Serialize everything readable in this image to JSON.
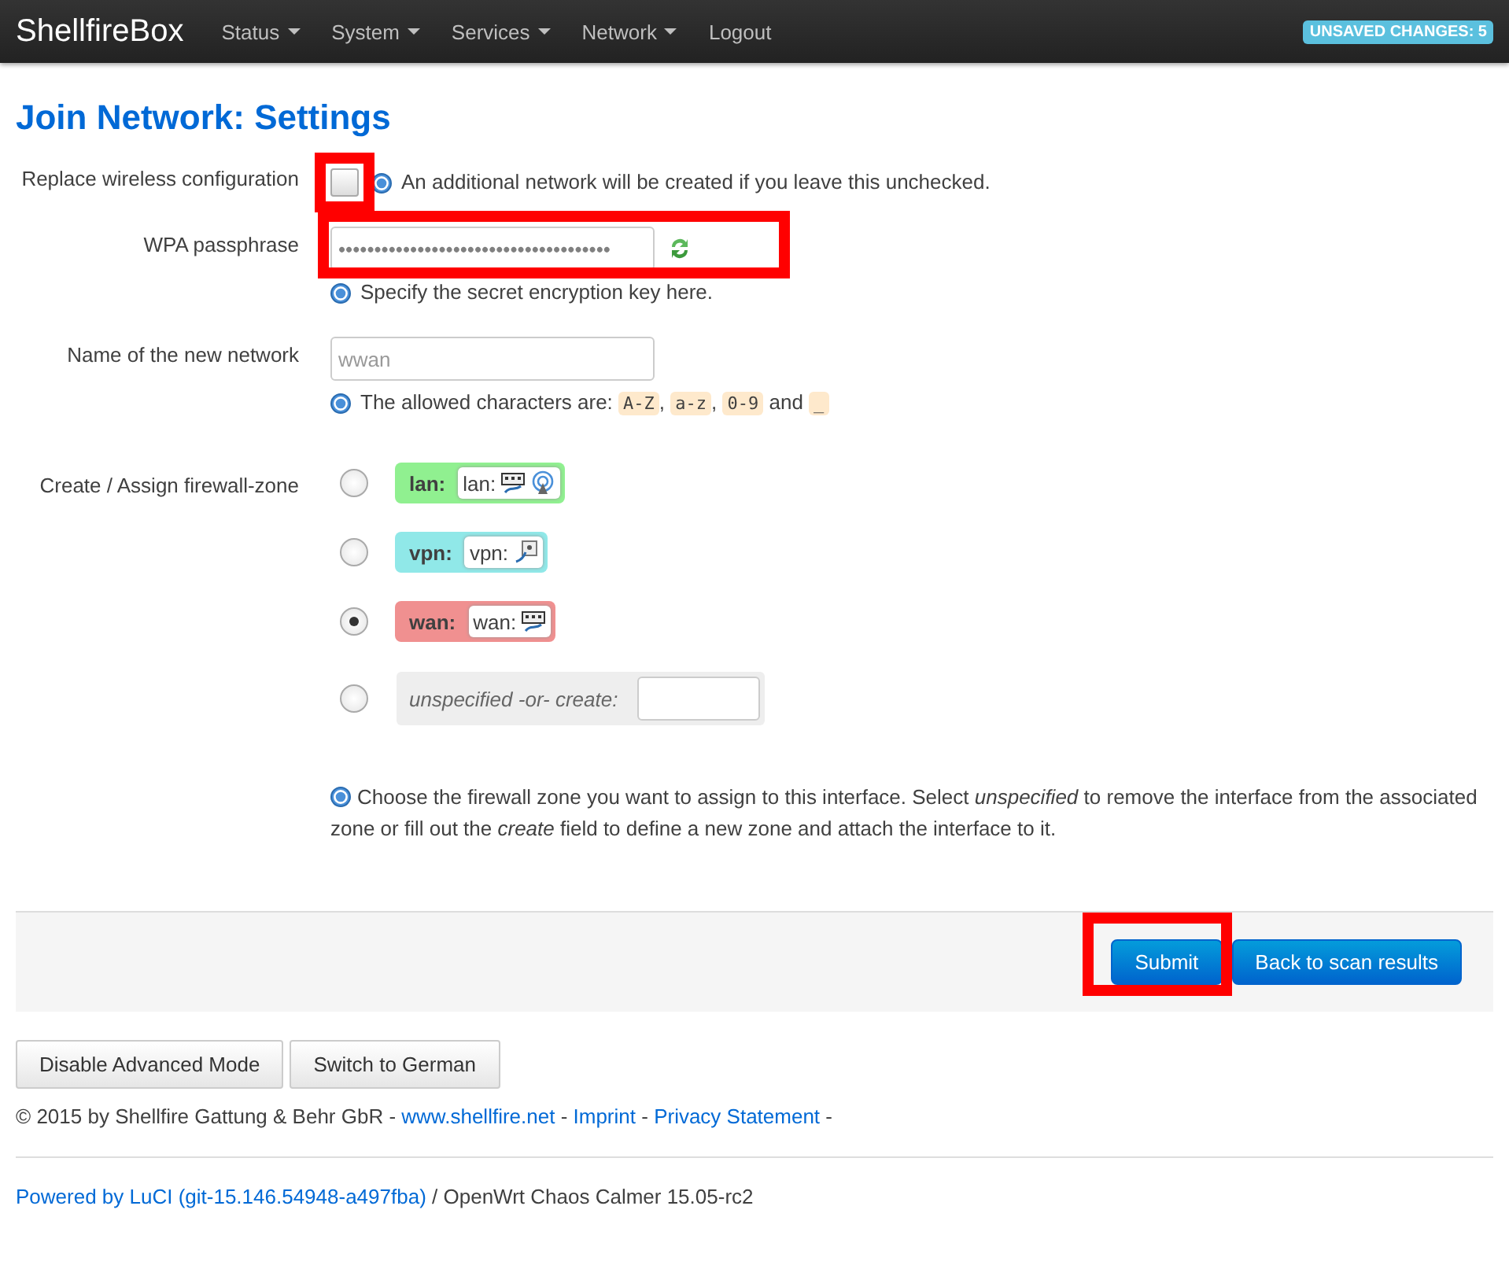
{
  "navbar": {
    "brand": "ShellfireBox",
    "menu": [
      {
        "label": "Status",
        "dropdown": true
      },
      {
        "label": "System",
        "dropdown": true
      },
      {
        "label": "Services",
        "dropdown": true
      },
      {
        "label": "Network",
        "dropdown": true
      },
      {
        "label": "Logout",
        "dropdown": false
      }
    ],
    "badge": "UNSAVED CHANGES: 5"
  },
  "title": "Join Network: Settings",
  "replace_wireless": {
    "label": "Replace wireless configuration",
    "checked": false,
    "highlighted": true,
    "help": "An additional network will be created if you leave this unchecked."
  },
  "passphrase": {
    "label": "WPA passphrase",
    "value": "••••••••••••••••••••••••••••••••••••••",
    "highlighted": true,
    "help": "Specify the secret encryption key here."
  },
  "network_name": {
    "label": "Name of the new network",
    "placeholder": "wwan",
    "help": [
      {
        "kind": "plain",
        "text": "The allowed characters are: "
      },
      {
        "kind": "code",
        "text": "A-Z"
      },
      {
        "kind": "plain",
        "text": ", "
      },
      {
        "kind": "code",
        "text": "a-z"
      },
      {
        "kind": "plain",
        "text": ", "
      },
      {
        "kind": "code",
        "text": "0-9"
      },
      {
        "kind": "plain",
        "text": " and "
      },
      {
        "kind": "code",
        "text": "_"
      }
    ]
  },
  "firewall": {
    "label": "Create / Assign firewall-zone",
    "zones": [
      {
        "kind": "zone",
        "name": "lan:",
        "inner": "lan:",
        "color": "#90f090",
        "selected": false,
        "icons": [
          {
            "kind": "ethernet"
          },
          {
            "kind": "wireless"
          }
        ]
      },
      {
        "kind": "zone",
        "name": "vpn:",
        "inner": "vpn:",
        "color": "#90e8e8",
        "selected": false,
        "icons": [
          {
            "kind": "tunnel"
          }
        ]
      },
      {
        "kind": "zone",
        "name": "wan:",
        "inner": "wan:",
        "color": "#f09090",
        "selected": true,
        "icons": [
          {
            "kind": "ethernet"
          }
        ]
      },
      {
        "kind": "create",
        "name": "unspecified -or- create:",
        "selected": false
      }
    ],
    "help": "Choose the firewall zone you want to assign to this interface. Select *unspecified* to remove the interface from the associated zone or fill out the *create* field to define a new zone and attach the interface to it."
  },
  "actions": [
    {
      "label": "Submit",
      "highlighted": true
    },
    {
      "label": "Back to scan results",
      "highlighted": false
    }
  ],
  "mode_buttons": [
    "Disable Advanced Mode",
    "Switch to German"
  ],
  "copyright": [
    {
      "kind": "text",
      "text": "© 2015 by Shellfire Gattung & Behr GbR - "
    },
    {
      "kind": "link",
      "text": "www.shellfire.net"
    },
    {
      "kind": "text",
      "text": " - "
    },
    {
      "kind": "link",
      "text": "Imprint"
    },
    {
      "kind": "text",
      "text": " - "
    },
    {
      "kind": "link",
      "text": "Privacy Statement"
    },
    {
      "kind": "text",
      "text": " -"
    }
  ],
  "powered": {
    "link": "Powered by LuCI (git-15.146.54948-a497fba)",
    "text": " / OpenWrt Chaos Calmer 15.05-rc2"
  }
}
